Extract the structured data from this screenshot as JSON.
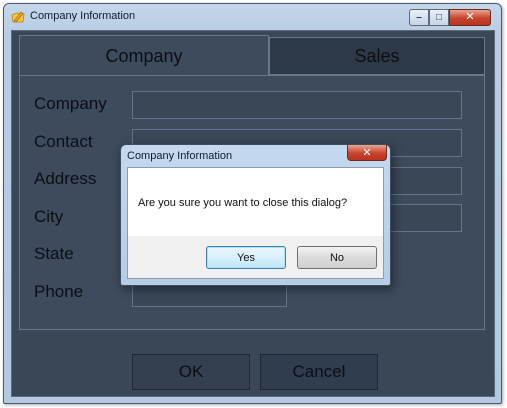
{
  "window": {
    "title": "Company Information",
    "controls": {
      "minimize": "–",
      "maximize": "□",
      "close": "✕"
    }
  },
  "tabs": [
    {
      "label": "Company",
      "selected": true
    },
    {
      "label": "Sales",
      "selected": false
    }
  ],
  "form": {
    "fields": [
      {
        "label": "Company",
        "value": ""
      },
      {
        "label": "Contact",
        "value": ""
      },
      {
        "label": "Address",
        "value": ""
      },
      {
        "label": "City",
        "value": ""
      },
      {
        "label": "State",
        "value": ""
      },
      {
        "label": "Phone",
        "value": ""
      }
    ]
  },
  "buttons": {
    "ok": "OK",
    "cancel": "Cancel"
  },
  "dialog": {
    "title": "Company Information",
    "close": "✕",
    "message": "Are you sure you want to close this dialog?",
    "yes": "Yes",
    "no": "No"
  },
  "colors": {
    "window_frame": "#b8cde4",
    "client_background": "#3a4757",
    "close_button": "#c7442d",
    "default_button_border": "#3c7fb1"
  },
  "icons": {
    "app": "folder-pencil-icon"
  }
}
